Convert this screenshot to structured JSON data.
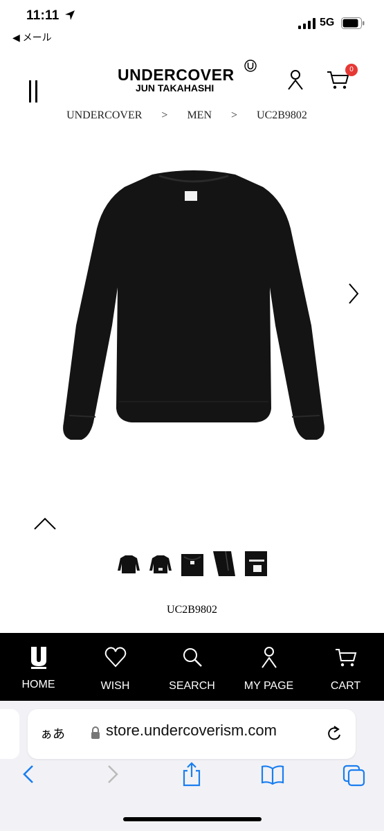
{
  "status": {
    "time": "11:11",
    "back_label": "◀ メール",
    "network": "5G"
  },
  "header": {
    "brand_main": "UNDERCOVER",
    "brand_sub": "JUN TAKAHASHI",
    "brand_mark": "U",
    "cart_count": "0"
  },
  "breadcrumb": {
    "items": [
      "UNDERCOVER",
      "MEN",
      "UC2B9802"
    ],
    "separator": ">"
  },
  "product": {
    "sku": "UC2B9802",
    "thumbnail_count": 5
  },
  "bottom_nav": {
    "items": [
      {
        "label": "HOME",
        "icon": "u-logo-icon"
      },
      {
        "label": "WISH",
        "icon": "heart-icon"
      },
      {
        "label": "SEARCH",
        "icon": "search-icon"
      },
      {
        "label": "MY PAGE",
        "icon": "user-icon"
      },
      {
        "label": "CART",
        "icon": "cart-icon"
      }
    ]
  },
  "browser": {
    "aa_label": "ぁあ",
    "url": "store.undercoverism.com"
  },
  "colors": {
    "accent": "#1a7ef0",
    "badge": "#e53935",
    "nav_bg": "#000000"
  }
}
